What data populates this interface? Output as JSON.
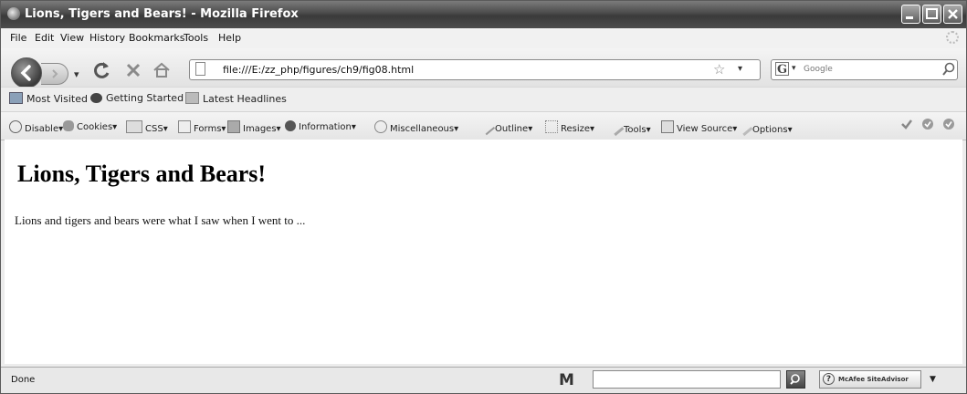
{
  "window": {
    "title": "Lions, Tigers and Bears! - Mozilla Firefox"
  },
  "menu": [
    "File",
    "Edit",
    "View",
    "History",
    "Bookmarks",
    "Tools",
    "Help"
  ],
  "nav": {
    "url": "file:///E:/zz_php/figures/ch9/fig08.html",
    "search_placeholder": "Google",
    "search_engine_letter": "G"
  },
  "bookmarks": [
    "Most Visited",
    "Getting Started",
    "Latest Headlines"
  ],
  "webdev": [
    "Disable",
    "Cookies",
    "CSS",
    "Forms",
    "Images",
    "Information",
    "Miscellaneous",
    "Outline",
    "Resize",
    "Tools",
    "View Source",
    "Options"
  ],
  "page": {
    "heading": "Lions, Tigers and Bears!",
    "paragraph": "Lions and tigers and bears were what I saw when I went to ..."
  },
  "status": {
    "text": "Done",
    "m_logo": "M",
    "siteadvisor": "McAfee SiteAdvisor"
  }
}
